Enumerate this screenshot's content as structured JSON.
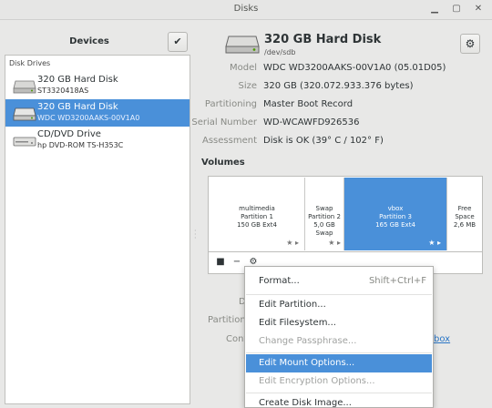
{
  "window": {
    "title": "Disks"
  },
  "sidebar": {
    "title": "Devices",
    "group_label": "Disk Drives",
    "drives": [
      {
        "name": "320 GB Hard Disk",
        "sub": "ST3320418AS",
        "icon": "hard-disk-icon"
      },
      {
        "name": "320 GB Hard Disk",
        "sub": "WDC WD3200AAKS-00V1A0",
        "icon": "hard-disk-icon",
        "selected": true
      },
      {
        "name": "CD/DVD Drive",
        "sub": "hp     DVD-ROM TS-H353C",
        "icon": "optical-drive-icon"
      }
    ]
  },
  "disk": {
    "title": "320 GB Hard Disk",
    "device": "/dev/sdb",
    "properties": [
      {
        "label": "Model",
        "value": "WDC WD3200AAKS-00V1A0 (05.01D05)"
      },
      {
        "label": "Size",
        "value": "320 GB (320.072.933.376 bytes)"
      },
      {
        "label": "Partitioning",
        "value": "Master Boot Record"
      },
      {
        "label": "Serial Number",
        "value": "WD-WCAWFD926536"
      },
      {
        "label": "Assessment",
        "value": "Disk is OK (39° C / 102° F)"
      }
    ]
  },
  "volumes": {
    "title": "Volumes",
    "partitions": [
      {
        "line1": "multimedia",
        "line2": "Partition 1",
        "line3": "150 GB Ext4"
      },
      {
        "line1": "Swap",
        "line2": "Partition 2",
        "line3": "5,0 GB Swap"
      },
      {
        "line1": "vbox",
        "line2": "Partition 3",
        "line3": "165 GB Ext4"
      },
      {
        "line1": "Free Space",
        "line2": "2,6 MB",
        "line3": ""
      }
    ]
  },
  "behind": {
    "label_d": "D",
    "label_partition": "Partition",
    "label_cont": "Cont",
    "link_tail": "box"
  },
  "menu": {
    "items": [
      {
        "label": "Format...",
        "accel": "Shift+Ctrl+F"
      },
      {
        "label": "Edit Partition..."
      },
      {
        "label": "Edit Filesystem..."
      },
      {
        "label": "Change Passphrase..."
      },
      {
        "label": "Edit Mount Options..."
      },
      {
        "label": "Edit Encryption Options..."
      },
      {
        "label": "Create Disk Image..."
      }
    ]
  },
  "colors": {
    "accent": "#4a90d9",
    "link": "#2a76c6"
  }
}
